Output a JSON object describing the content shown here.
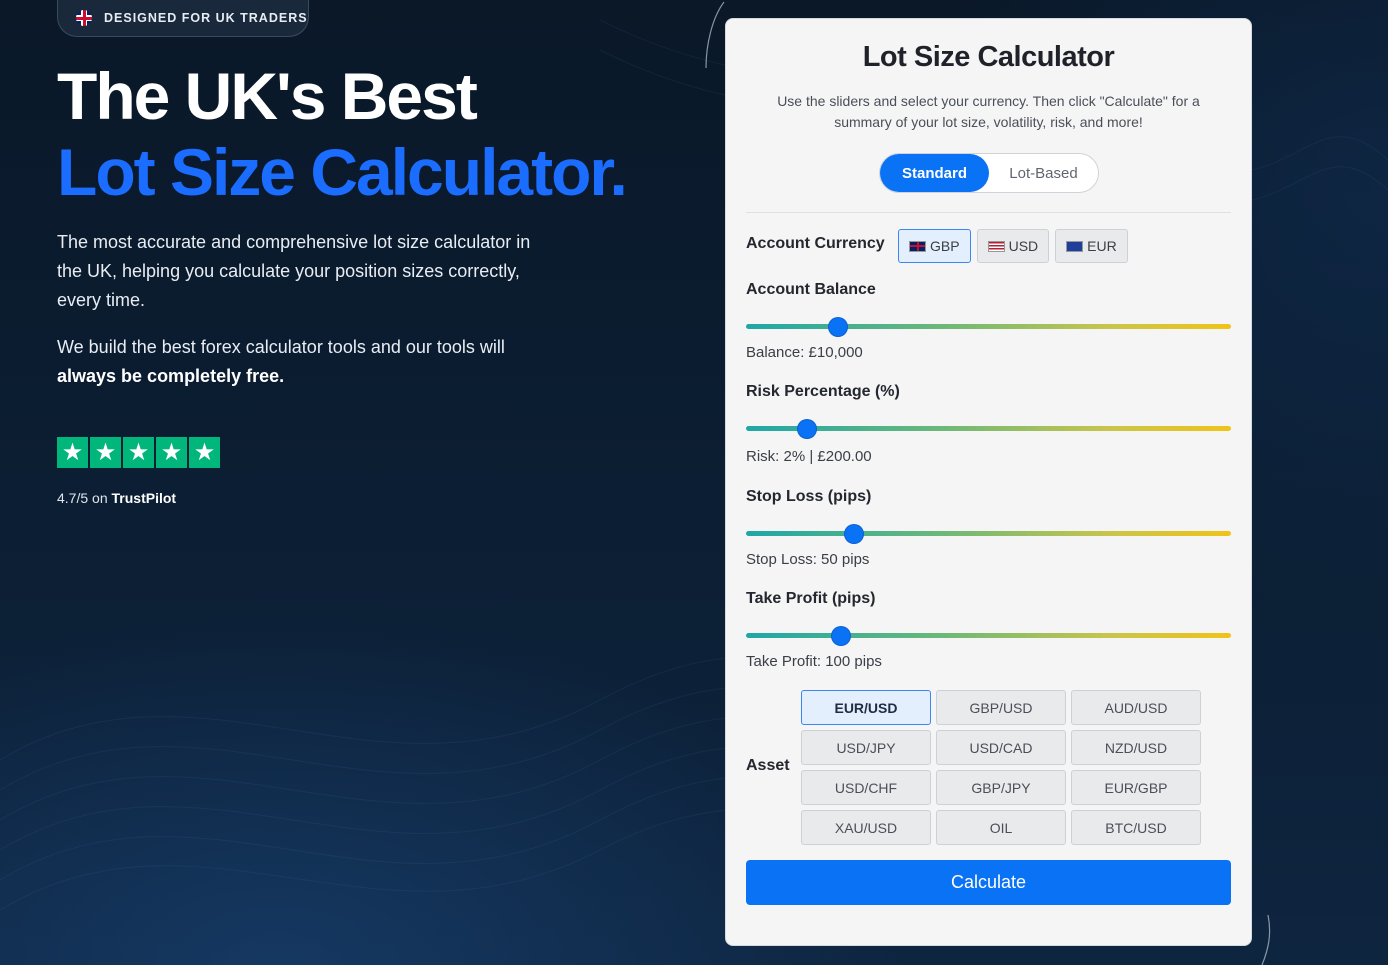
{
  "hero": {
    "badge": "DESIGNED FOR UK TRADERS",
    "title_line1": "The UK's Best",
    "title_line2": "Lot Size Calculator.",
    "description": "The most accurate and comprehensive lot size calculator in the UK, helping you calculate your position sizes correctly, every time.",
    "tools_text": "We build the best forex calculator tools and our tools will",
    "tools_bold": "always be completely free.",
    "rating_prefix": "4.7/5 on",
    "rating_source": "TrustPilot",
    "stars": 5,
    "star_color": "#00b67a"
  },
  "calculator": {
    "title": "Lot Size Calculator",
    "subtitle": "Use the sliders and select your currency. Then click \"Calculate\" for a summary of your lot size, volatility, risk, and more!",
    "modes": [
      {
        "label": "Standard",
        "active": true
      },
      {
        "label": "Lot-Based",
        "active": false
      }
    ],
    "account_currency": {
      "label": "Account Currency",
      "options": [
        {
          "label": "GBP",
          "flag": "gb-flag-icon",
          "active": true
        },
        {
          "label": "USD",
          "flag": "us-flag-icon",
          "active": false
        },
        {
          "label": "EUR",
          "flag": "eu-flag-icon",
          "active": false
        }
      ]
    },
    "sliders": [
      {
        "label": "Account Balance",
        "readout": "Balance: £10,000",
        "position": 0.19
      },
      {
        "label": "Risk Percentage (%)",
        "readout": "Risk: 2% | £200.00",
        "position": 0.126
      },
      {
        "label": "Stop Loss (pips)",
        "readout": "Stop Loss: 50 pips",
        "position": 0.222
      },
      {
        "label": "Take Profit (pips)",
        "readout": "Take Profit: 100 pips",
        "position": 0.196
      }
    ],
    "asset": {
      "label": "Asset",
      "options": [
        "EUR/USD",
        "GBP/USD",
        "AUD/USD",
        "USD/JPY",
        "USD/CAD",
        "NZD/USD",
        "USD/CHF",
        "GBP/JPY",
        "EUR/GBP",
        "XAU/USD",
        "OIL",
        "BTC/USD"
      ],
      "selected": "EUR/USD"
    },
    "calculate_label": "Calculate",
    "accent_color": "#0a72f5"
  }
}
